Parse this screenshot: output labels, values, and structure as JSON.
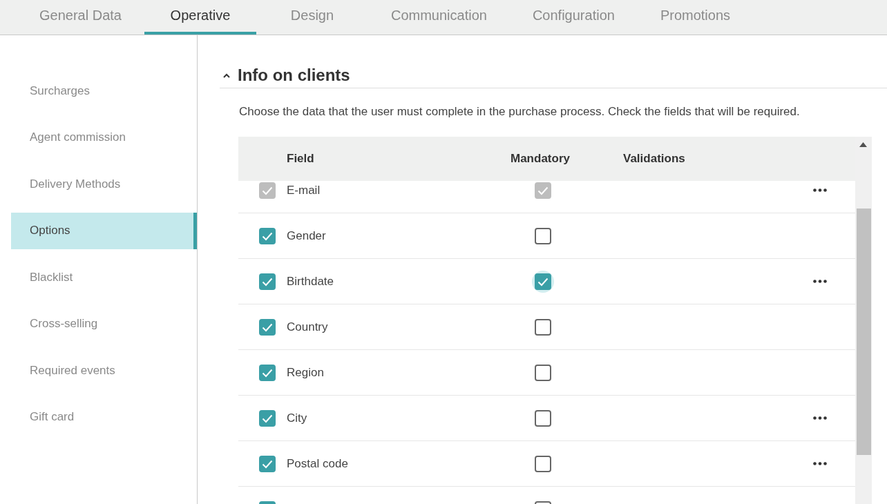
{
  "tabs": [
    {
      "label": "General Data",
      "selected": false
    },
    {
      "label": "Operative",
      "selected": true
    },
    {
      "label": "Design",
      "selected": false
    },
    {
      "label": "Communication",
      "selected": false
    },
    {
      "label": "Configuration",
      "selected": false
    },
    {
      "label": "Promotions",
      "selected": false
    }
  ],
  "sidebar": {
    "items": [
      {
        "label": "Surcharges",
        "selected": false
      },
      {
        "label": "Agent commission",
        "selected": false
      },
      {
        "label": "Delivery Methods",
        "selected": false
      },
      {
        "label": "Options",
        "selected": true
      },
      {
        "label": "Blacklist",
        "selected": false
      },
      {
        "label": "Cross-selling",
        "selected": false
      },
      {
        "label": "Required events",
        "selected": false
      },
      {
        "label": "Gift card",
        "selected": false
      }
    ]
  },
  "section": {
    "title": "Info on clients",
    "expanded": true,
    "description": "Choose the data that the user must complete in the purchase process. Check the fields that will be required."
  },
  "table": {
    "columns": [
      "Field",
      "Mandatory",
      "Validations"
    ],
    "rows": [
      {
        "field": "E-mail",
        "included": {
          "checked": true,
          "disabled": true
        },
        "mandatory": {
          "checked": true,
          "disabled": true,
          "focused": false
        },
        "validations_menu": true
      },
      {
        "field": "Gender",
        "included": {
          "checked": true,
          "disabled": false
        },
        "mandatory": {
          "checked": false,
          "disabled": false,
          "focused": false
        },
        "validations_menu": false
      },
      {
        "field": "Birthdate",
        "included": {
          "checked": true,
          "disabled": false
        },
        "mandatory": {
          "checked": true,
          "disabled": false,
          "focused": true
        },
        "validations_menu": true
      },
      {
        "field": "Country",
        "included": {
          "checked": true,
          "disabled": false
        },
        "mandatory": {
          "checked": false,
          "disabled": false,
          "focused": false
        },
        "validations_menu": false
      },
      {
        "field": "Region",
        "included": {
          "checked": true,
          "disabled": false
        },
        "mandatory": {
          "checked": false,
          "disabled": false,
          "focused": false
        },
        "validations_menu": false
      },
      {
        "field": "City",
        "included": {
          "checked": true,
          "disabled": false
        },
        "mandatory": {
          "checked": false,
          "disabled": false,
          "focused": false
        },
        "validations_menu": true
      },
      {
        "field": "Postal code",
        "included": {
          "checked": true,
          "disabled": false
        },
        "mandatory": {
          "checked": false,
          "disabled": false,
          "focused": false
        },
        "validations_menu": true
      },
      {
        "included": {
          "checked": true,
          "disabled": false
        },
        "mandatory": {
          "checked": false,
          "disabled": false,
          "focused": false
        }
      }
    ]
  }
}
